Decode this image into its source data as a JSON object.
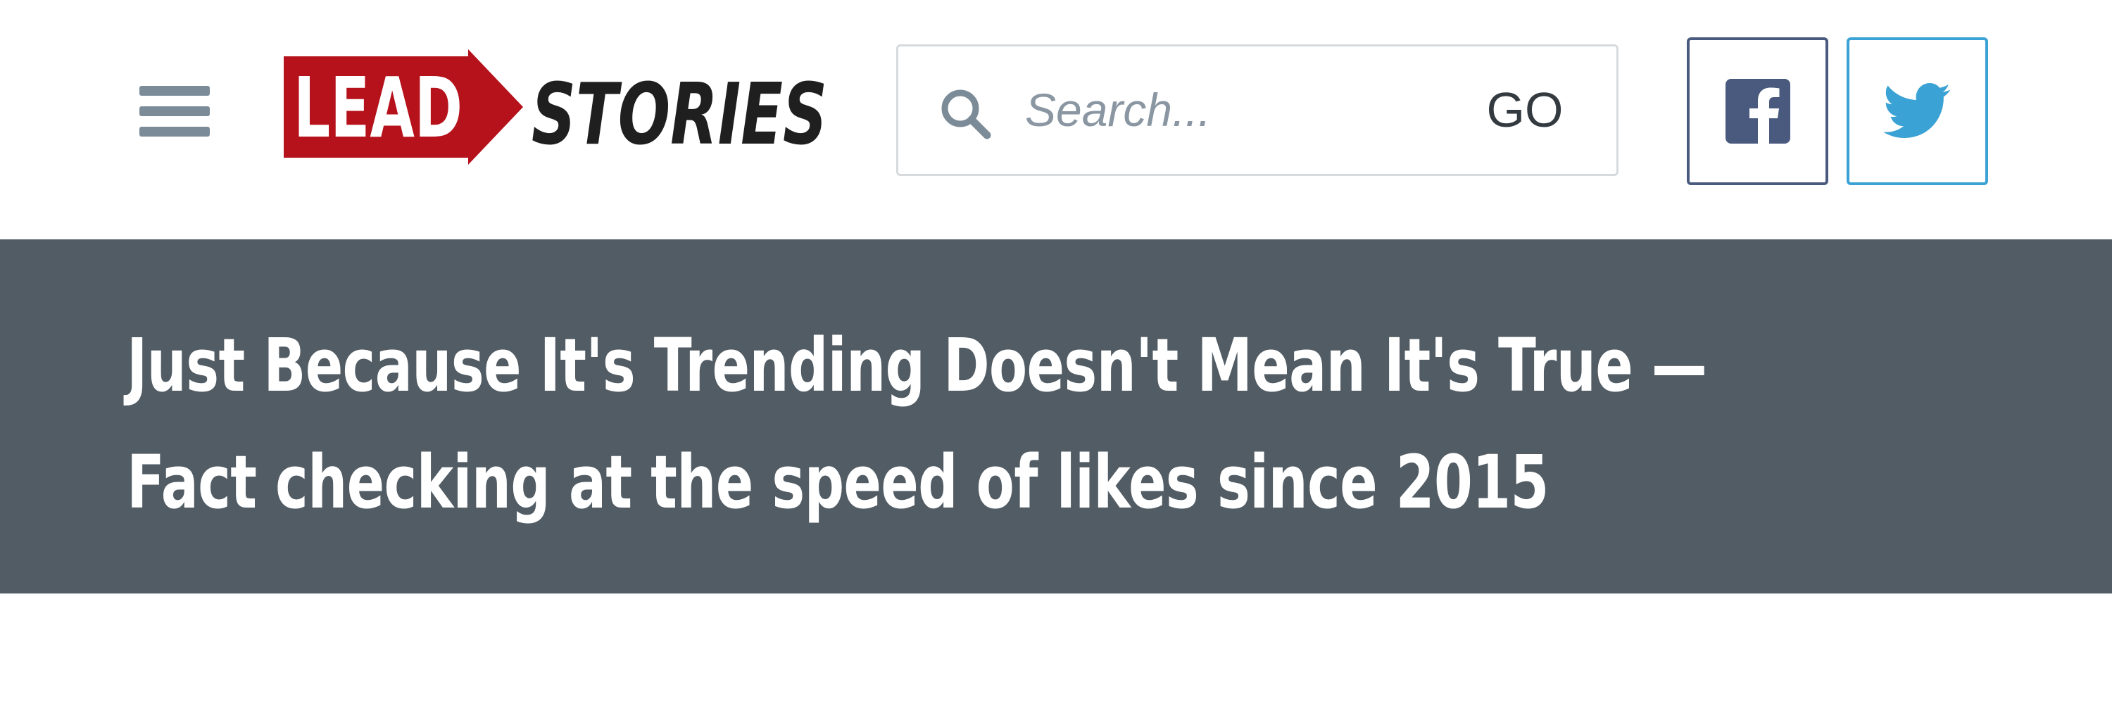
{
  "header": {
    "menu_icon": "hamburger-menu-icon",
    "logo": {
      "text_left": "LEAD",
      "text_right": "STORIES",
      "colors": {
        "red": "#b5121b",
        "dark": "#1f1f1f"
      }
    },
    "search": {
      "placeholder": "Search...",
      "icon": "search-icon",
      "go_label": "GO"
    },
    "social": [
      {
        "name": "facebook",
        "icon": "facebook-icon",
        "color": "#4a5a7e"
      },
      {
        "name": "twitter",
        "icon": "twitter-icon",
        "color": "#3aa2d4"
      }
    ]
  },
  "banner": {
    "tagline_line1": "Just Because It's Trending Doesn't Mean It's True —",
    "tagline_line2": "Fact checking at the speed of likes since 2015",
    "background": "#525c64"
  }
}
